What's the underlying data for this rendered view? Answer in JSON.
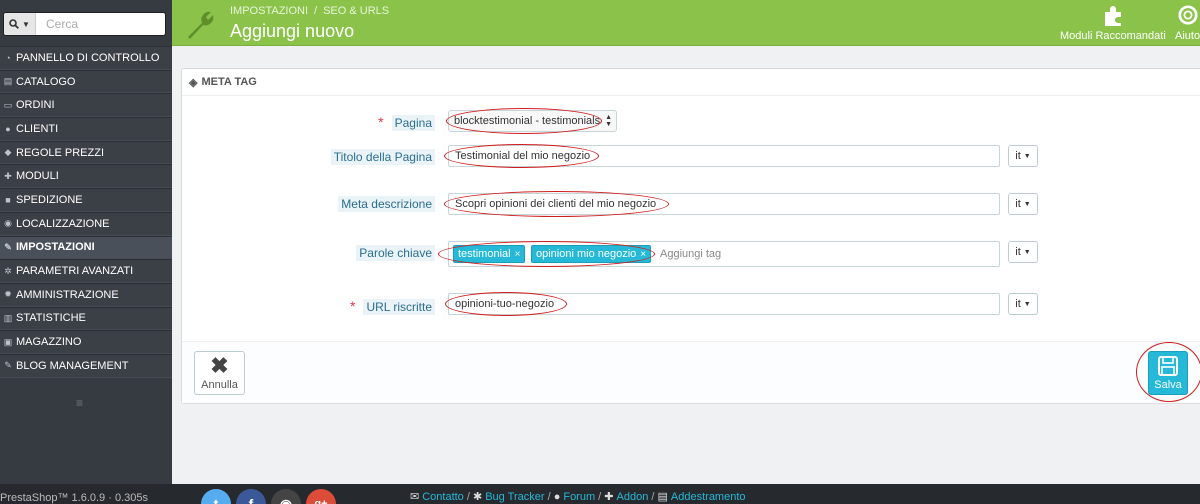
{
  "sidebar": {
    "search": {
      "placeholder": "Cerca"
    },
    "items": [
      {
        "label": "PANNELLO DI CONTROLLO",
        "icon": "dashboard-icon"
      },
      {
        "label": "CATALOGO",
        "icon": "book-icon"
      },
      {
        "label": "ORDINI",
        "icon": "credit-card-icon"
      },
      {
        "label": "CLIENTI",
        "icon": "users-icon"
      },
      {
        "label": "REGOLE PREZZI",
        "icon": "tags-icon"
      },
      {
        "label": "MODULI",
        "icon": "puzzle-icon"
      },
      {
        "label": "SPEDIZIONE",
        "icon": "truck-icon"
      },
      {
        "label": "LOCALIZZAZIONE",
        "icon": "globe-icon"
      },
      {
        "label": "IMPOSTAZIONI",
        "icon": "wrench-icon",
        "active": true
      },
      {
        "label": "PARAMETRI AVANZATI",
        "icon": "cogs-icon"
      },
      {
        "label": "AMMINISTRAZIONE",
        "icon": "cog-icon"
      },
      {
        "label": "STATISTICHE",
        "icon": "bar-chart-icon"
      },
      {
        "label": "MAGAZZINO",
        "icon": "archive-icon"
      },
      {
        "label": "BLOG MANAGEMENT",
        "icon": "pencil-icon"
      }
    ]
  },
  "header": {
    "breadcrumb": [
      "IMPOSTAZIONI",
      "SEO & URLS"
    ],
    "title": "Aggiungi nuovo",
    "toolbar": {
      "recommended_label": "Moduli Raccomandati",
      "help_label": "Aiuto"
    }
  },
  "panel": {
    "heading": "META TAG",
    "fields": {
      "page": {
        "label": "Pagina",
        "value": "blocktestimonial - testimonials"
      },
      "page_title": {
        "label": "Titolo della Pagina",
        "value": "Testimonial del mio negozio",
        "lang": "it"
      },
      "meta_description": {
        "label": "Meta descrizione",
        "value": "Scopri opinioni dei clienti del mio negozio",
        "lang": "it"
      },
      "keywords": {
        "label": "Parole chiave",
        "tags": [
          "testimonial",
          "opinioni mio negozio"
        ],
        "placeholder": "Aggiungi tag",
        "lang": "it"
      },
      "rewritten_url": {
        "label": "URL riscritte",
        "value": "opinioni-tuo-negozio",
        "lang": "it"
      }
    },
    "footer": {
      "cancel_label": "Annulla",
      "save_label": "Salva"
    }
  },
  "footer": {
    "version": "PrestaShop™ 1.6.0.9 · 0.305s",
    "links": [
      "Contatto",
      "Bug Tracker",
      "Forum",
      "Addon",
      "Addestramento"
    ]
  },
  "colors": {
    "header": "#8bc34a",
    "sidebar": "#363a41",
    "accent": "#25b9d7",
    "annotation": "#d01c1c"
  }
}
